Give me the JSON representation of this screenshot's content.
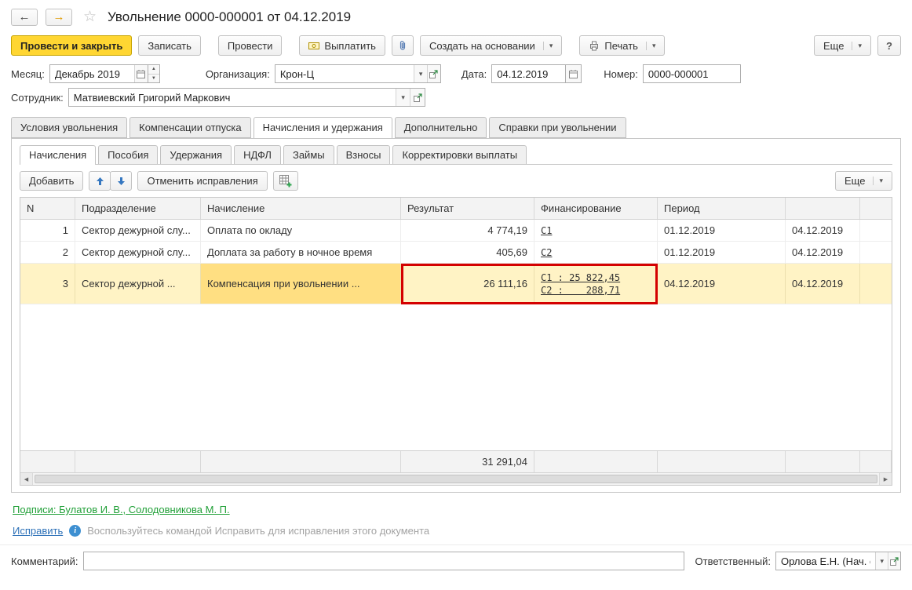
{
  "colors": {
    "accent_yellow": "#ffd632",
    "selected_row": "#fff3c5",
    "selected_cell": "#ffdf82",
    "highlight_red": "#d40000",
    "link_green": "#21a038",
    "link_blue": "#2d71b8"
  },
  "icons": {
    "back": "←",
    "forward": "→",
    "favorite_star": "☆",
    "dropdown": "▾",
    "spin_up": "▲",
    "spin_down": "▼",
    "scroll_left": "◀",
    "scroll_right": "▶",
    "info": "i"
  },
  "titlebar": {
    "title": "Увольнение 0000-000001 от 04.12.2019"
  },
  "toolbar": {
    "post_and_close": "Провести и закрыть",
    "write": "Записать",
    "post": "Провести",
    "pay": "Выплатить",
    "create_on_basis": "Создать на основании",
    "print": "Печать",
    "more": "Еще",
    "help": "?"
  },
  "fields": {
    "month": {
      "label": "Месяц:",
      "value": "Декабрь 2019"
    },
    "organization": {
      "label": "Организация:",
      "value": "Крон-Ц"
    },
    "date": {
      "label": "Дата:",
      "value": "04.12.2019"
    },
    "number": {
      "label": "Номер:",
      "value": "0000-000001"
    },
    "employee": {
      "label": "Сотрудник:",
      "value": "Матвиевский Григорий Маркович"
    }
  },
  "tabs_main": [
    {
      "label": "Условия увольнения"
    },
    {
      "label": "Компенсации отпуска"
    },
    {
      "label": "Начисления и удержания"
    },
    {
      "label": "Дополнительно"
    },
    {
      "label": "Справки при увольнении"
    }
  ],
  "tabs_sub": [
    {
      "label": "Начисления"
    },
    {
      "label": "Пособия"
    },
    {
      "label": "Удержания"
    },
    {
      "label": "НДФЛ"
    },
    {
      "label": "Займы"
    },
    {
      "label": "Взносы"
    },
    {
      "label": "Корректировки выплаты"
    }
  ],
  "grid_toolbar": {
    "add": "Добавить",
    "cancel_corrections": "Отменить исправления",
    "more": "Еще"
  },
  "grid": {
    "columns": [
      "N",
      "Подразделение",
      "Начисление",
      "Результат",
      "Финансирование",
      "Период",
      "",
      ""
    ],
    "rows": [
      {
        "n": "1",
        "department": "Сектор дежурной слу...",
        "accrual": "Оплата по окладу",
        "result": "4 774,19",
        "financing": "С1",
        "period_start": "01.12.2019",
        "period_end": "04.12.2019"
      },
      {
        "n": "2",
        "department": "Сектор дежурной слу...",
        "accrual": "Доплата за работу в ночное время",
        "result": "405,69",
        "financing": "С2",
        "period_start": "01.12.2019",
        "period_end": "04.12.2019"
      },
      {
        "n": "3",
        "department": "Сектор дежурной ...",
        "accrual": "Компенсация при увольнении ...",
        "result": "26 111,16",
        "financing_lines": [
          "С1 : 25 822,45",
          "С2 :    288,71"
        ],
        "period_start": "04.12.2019",
        "period_end": "04.12.2019"
      }
    ],
    "total": "31 291,04"
  },
  "footer": {
    "signatures": "Подписи: Булатов И. В., Солодовникова М. П.",
    "fix_link": "Исправить",
    "fix_hint": "Воспользуйтесь командой Исправить для исправления этого документа",
    "comment_label": "Комментарий:",
    "comment_value": "",
    "responsible_label": "Ответственный:",
    "responsible_value": "Орлова Е.Н. (Нач. отд. ра"
  }
}
